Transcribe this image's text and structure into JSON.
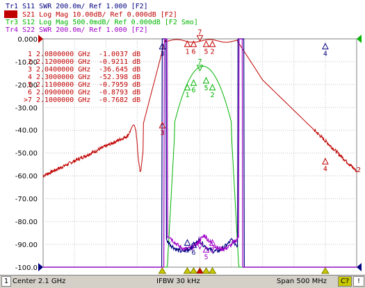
{
  "traces": [
    {
      "id": "Tr1",
      "label": "Tr1  S11  SWR 200.0m/ Ref 1.000 [F2]",
      "color": "#000080"
    },
    {
      "id": "Tr2",
      "label": "Tr2  S21  Log Mag 10.00dB/ Ref 0.000dB [F2]",
      "color": "#c00000"
    },
    {
      "id": "Tr3",
      "label": "Tr3  S12  Log Mag 500.0mdB/ Ref 0.000dB [F2 Smo]",
      "color": "#00b400"
    },
    {
      "id": "Tr4",
      "label": "Tr4  S22  SWR 200.0m/ Ref 1.000 [F2]",
      "color": "#a000c8"
    }
  ],
  "y_axis_labels": [
    "0.000",
    "-10.00",
    "-20.00",
    "-30.00",
    "-40.00",
    "-50.00",
    "-60.00",
    "-70.00",
    "-80.00",
    "-90.00",
    "-100.0"
  ],
  "marker_table": [
    {
      "num": "1",
      "freq": "2.0800000 GHz",
      "value": "-1.0037 dB"
    },
    {
      "num": "2",
      "freq": "2.1200000 GHz",
      "value": "-0.9211 dB"
    },
    {
      "num": "3",
      "freq": "2.0400000 GHz",
      "value": "-36.645 dB"
    },
    {
      "num": "4",
      "freq": "2.3000000 GHz",
      "value": "-52.398 dB"
    },
    {
      "num": "5",
      "freq": "2.1100000 GHz",
      "value": "-0.7959 dB"
    },
    {
      "num": "6",
      "freq": "2.0900000 GHz",
      "value": "-0.8793 dB"
    },
    {
      "num": ">7",
      "freq": "2.1000000 GHz",
      "value": "-0.7682 dB"
    }
  ],
  "trace_end_label": "2",
  "status_bar": {
    "channel": "1",
    "center": "Center 2.1 GHz",
    "ifbw": "IFBW 30 kHz",
    "span": "Span 500 MHz",
    "correction": "C?",
    "ext": "!"
  },
  "colors": {
    "grid": "#c0c0c0",
    "s11": "#000080",
    "s21": "#c00000",
    "s12": "#00b400",
    "s22": "#a000c8",
    "marker_stimulus": "#c8c800"
  }
}
